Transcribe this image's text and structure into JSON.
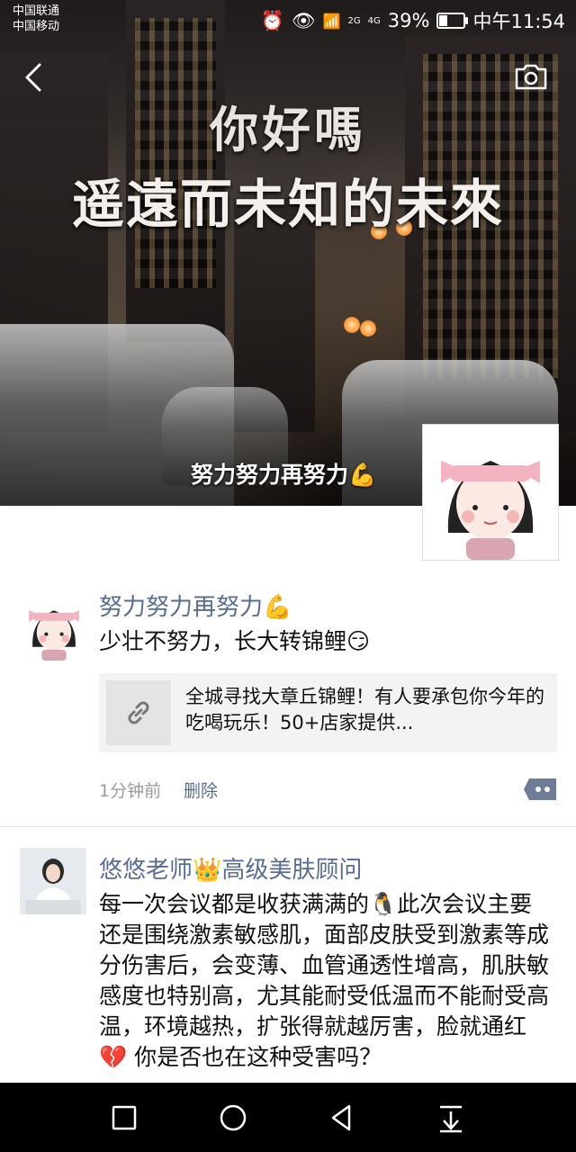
{
  "status_bar": {
    "carrier_1": "中国联通",
    "carrier_2": "中国移动",
    "network_1": "2G",
    "network_2": "4G",
    "battery": "39%",
    "time": "中午11:54",
    "battery_level": 0.39
  },
  "cover": {
    "title_line1": "你好嗎",
    "title_line2": "遥遠而未知的未來",
    "username": "努力努力再努力💪"
  },
  "posts": [
    {
      "author": "努力努力再努力💪",
      "text": "少壮不努力，长大转锦鲤😏",
      "link_title": "全城寻找大章丘锦鲤！有人要承包你今年的吃喝玩乐！50+店家提供...",
      "time": "1分钟前",
      "delete_label": "删除"
    },
    {
      "author": "悠悠老师👑高级美肤顾问",
      "text": "每一次会议都是收获满满的🐧此次会议主要还是围绕激素敏感肌，面部皮肤受到激素等成分伤害后，会变薄、血管通透性增高，肌肤敏感度也特别高，尤其能耐受低温而不能耐受高温，环境越热，扩张得就越厉害，脸就通红💔 你是否也在这种受害吗？"
    }
  ],
  "icons": {
    "back": "chevron-left-icon",
    "camera": "camera-icon",
    "link": "link-icon",
    "comment": "comment-icon",
    "nav_recent": "square-icon",
    "nav_home": "circle-icon",
    "nav_back": "triangle-back-icon",
    "nav_notifications": "pull-down-icon"
  },
  "colors": {
    "link_name": "#586c94",
    "meta": "#9b9b9b",
    "card_bg": "#f3f3f5"
  }
}
